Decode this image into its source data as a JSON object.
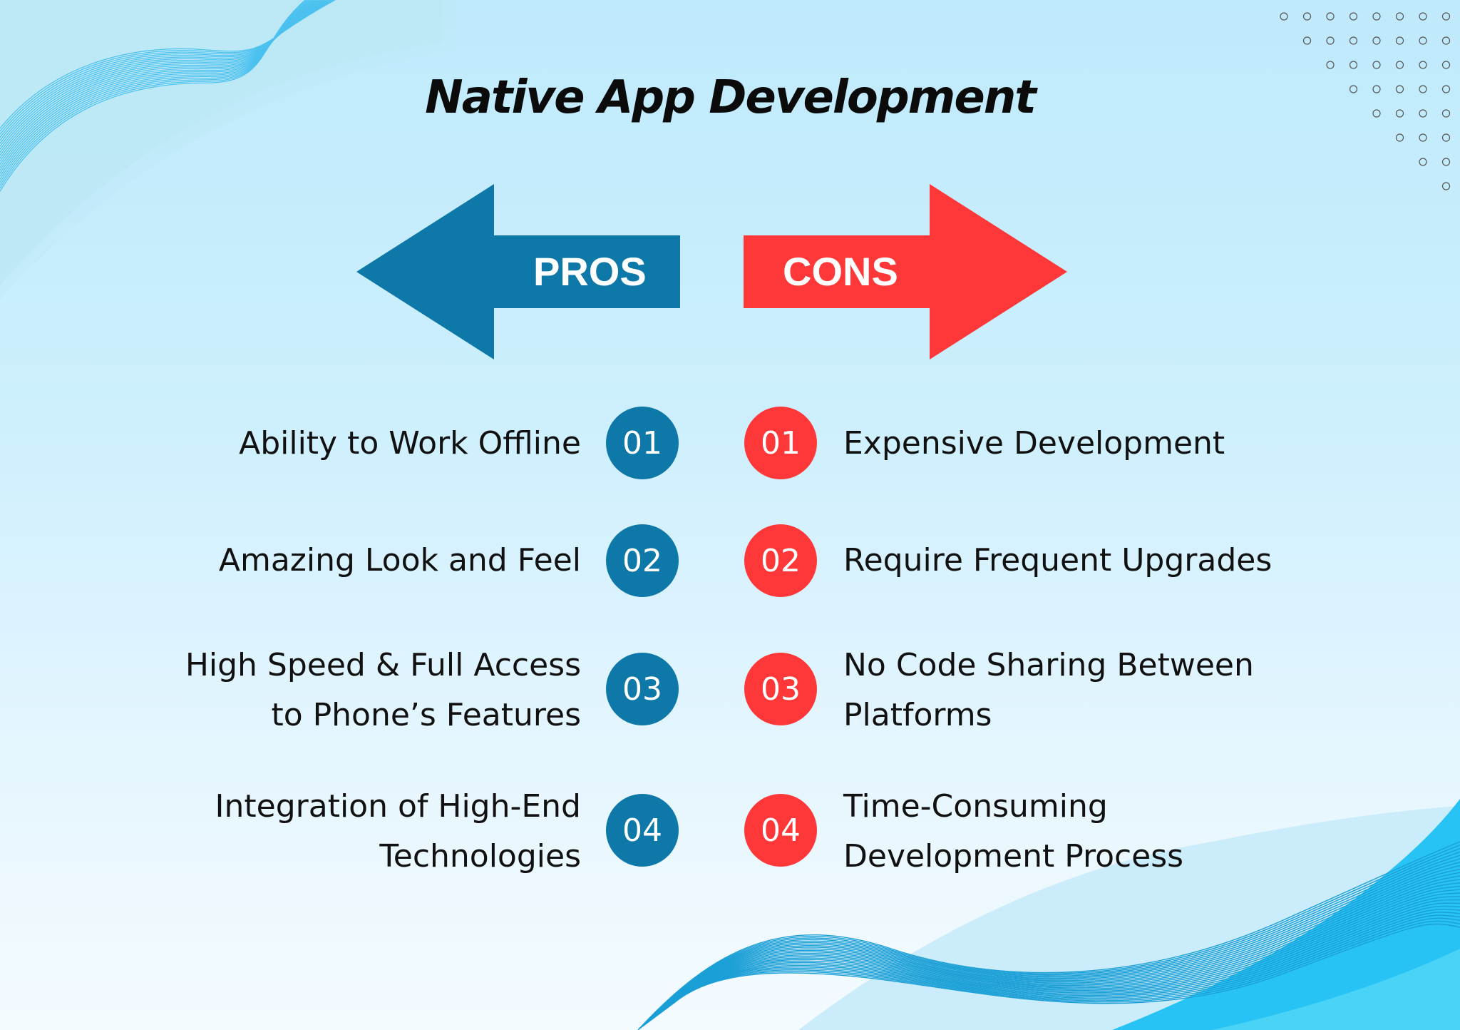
{
  "title": "Native App Development",
  "pros": {
    "label": "PROS",
    "color": "#0e78a8",
    "items": [
      {
        "number": "01",
        "lines": [
          "Ability to Work Offline"
        ]
      },
      {
        "number": "02",
        "lines": [
          "Amazing Look and Feel"
        ]
      },
      {
        "number": "03",
        "lines": [
          "High Speed & Full Access",
          "to Phone’s Features"
        ]
      },
      {
        "number": "04",
        "lines": [
          "Integration of High-End",
          "Technologies"
        ]
      }
    ]
  },
  "cons": {
    "label": "CONS",
    "color": "#fe3838",
    "items": [
      {
        "number": "01",
        "lines": [
          "Expensive Development"
        ]
      },
      {
        "number": "02",
        "lines": [
          "Require Frequent Upgrades"
        ]
      },
      {
        "number": "03",
        "lines": [
          "No Code Sharing Between",
          "Platforms"
        ]
      },
      {
        "number": "04",
        "lines": [
          "Time-Consuming",
          "Development Process"
        ]
      }
    ]
  },
  "decor": {
    "dot_grid_icon": "circle-dot-pattern",
    "wave_icon": "wave-lines"
  }
}
